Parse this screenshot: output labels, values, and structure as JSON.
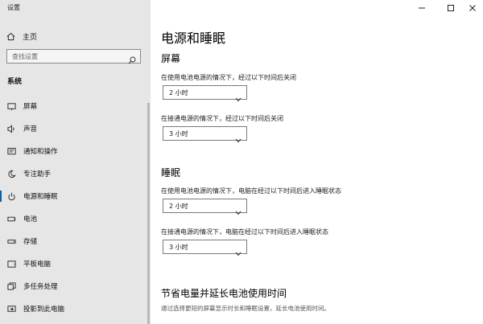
{
  "app": {
    "title": "设置"
  },
  "window": {
    "minimize": "—",
    "maximize": "☐",
    "close": "✕"
  },
  "sidebar": {
    "home_label": "主页",
    "search_placeholder": "查找设置",
    "section": "系统",
    "items": [
      {
        "label": "屏幕",
        "icon": "monitor-icon",
        "active": false
      },
      {
        "label": "声音",
        "icon": "speaker-icon",
        "active": false
      },
      {
        "label": "通知和操作",
        "icon": "notification-icon",
        "active": false
      },
      {
        "label": "专注助手",
        "icon": "moon-icon",
        "active": false
      },
      {
        "label": "电源和睡眠",
        "icon": "power-icon",
        "active": true
      },
      {
        "label": "电池",
        "icon": "battery-icon",
        "active": false
      },
      {
        "label": "存储",
        "icon": "storage-icon",
        "active": false
      },
      {
        "label": "平板电脑",
        "icon": "tablet-icon",
        "active": false
      },
      {
        "label": "多任务处理",
        "icon": "multitask-icon",
        "active": false
      },
      {
        "label": "投影到此电脑",
        "icon": "project-icon",
        "active": false
      }
    ]
  },
  "main": {
    "title": "电源和睡眠",
    "screen": {
      "heading": "屏幕",
      "battery_label": "在使用电池电源的情况下，经过以下时间后关闭",
      "battery_value": "2 小时",
      "plugged_label": "在接通电源的情况下，经过以下时间后关闭",
      "plugged_value": "3 小时"
    },
    "sleep": {
      "heading": "睡眠",
      "battery_label": "在使用电池电源的情况下，电脑在经过以下时间后进入睡眠状态",
      "battery_value": "2 小时",
      "plugged_label": "在接通电源的情况下，电脑在经过以下时间后进入睡眠状态",
      "plugged_value": "3 小时"
    },
    "save": {
      "heading": "节省电量并延长电池使用时间",
      "desc": "通过选择更短的屏幕显示时长和睡眠设置，延长电池使用时间。"
    }
  },
  "colors": {
    "accent": "#0063b1",
    "sidebar_bg": "#e6e6e6"
  }
}
